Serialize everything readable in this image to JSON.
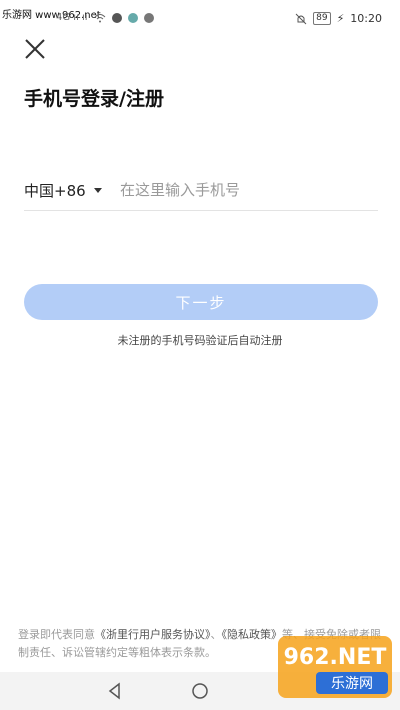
{
  "status_bar": {
    "watermark": "乐游网 www.962.net",
    "carrier_icons": "4G ıı ıı",
    "battery": "89",
    "time": "10:20"
  },
  "header": {
    "close_icon": "close-icon",
    "title": "手机号登录/注册"
  },
  "form": {
    "country_code": "中国+86",
    "phone_placeholder": "在这里输入手机号",
    "next_label": "下一步",
    "hint": "未注册的手机号码验证后自动注册"
  },
  "terms": {
    "prefix": "登录即代表同意",
    "service_link": "《浙里行用户服务协议》",
    "sep": "、",
    "privacy_link": "《隐私政策》",
    "suffix": "等、接受免除或者限制责任、诉讼管辖约定等粗体表示条款。"
  },
  "watermark_logo": {
    "brand": "962.NET",
    "sub": "乐游网"
  },
  "colors": {
    "button": "#b3cdf7",
    "accent": "#3a7bf0"
  }
}
